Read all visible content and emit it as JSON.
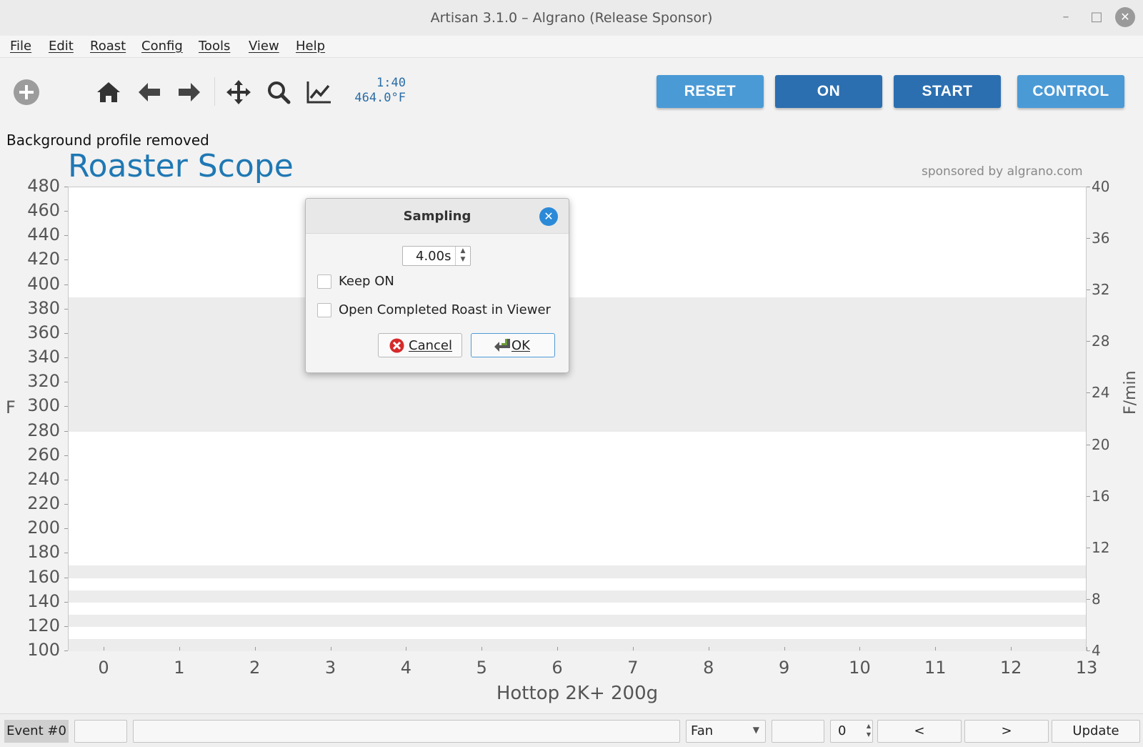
{
  "window": {
    "title": "Artisan 3.1.0 – Algrano (Release Sponsor)",
    "minimize": "–",
    "maximize": "□",
    "close": "✕"
  },
  "menu": [
    "File",
    "Edit",
    "Roast",
    "Config",
    "Tools",
    "View",
    "Help"
  ],
  "toolbar": {
    "time": "1:40",
    "temperature": "464.0°F",
    "buttons": [
      {
        "label": "RESET",
        "color": "#4a9ad6"
      },
      {
        "label": "ON",
        "color": "#2b6fb0"
      },
      {
        "label": "START",
        "color": "#2b6fb0"
      },
      {
        "label": "CONTROL",
        "color": "#4a9ad6"
      }
    ]
  },
  "status": "Background profile removed",
  "chart_data": {
    "type": "line",
    "title": "Roaster Scope",
    "sponsor": "sponsored by algrano.com",
    "xlabel": "Hottop 2K+ 200g",
    "ylabel": "F",
    "ylabel_right": "F/min",
    "xlim": [
      0,
      13
    ],
    "ylim": [
      100,
      480
    ],
    "ylim_right": [
      4,
      40
    ],
    "x_ticks": [
      "0",
      "1",
      "2",
      "3",
      "4",
      "5",
      "6",
      "7",
      "8",
      "9",
      "10",
      "11",
      "12",
      "13"
    ],
    "y_ticks": [
      "480",
      "460",
      "440",
      "420",
      "400",
      "380",
      "360",
      "340",
      "320",
      "300",
      "280",
      "260",
      "240",
      "220",
      "200",
      "180",
      "160",
      "140",
      "120",
      "100"
    ],
    "y_ticks_right": [
      "40",
      "36",
      "32",
      "28",
      "24",
      "20",
      "16",
      "12",
      "8",
      "4"
    ],
    "shaded_bands": [
      [
        280,
        390
      ],
      [
        160,
        170
      ],
      [
        140,
        150
      ],
      [
        120,
        130
      ],
      [
        100,
        110
      ]
    ],
    "series": []
  },
  "dialog": {
    "title": "Sampling",
    "interval": "4.00s",
    "keep_on": "Keep ON",
    "open_viewer": "Open Completed Roast in Viewer",
    "cancel": "Cancel",
    "ok": "OK"
  },
  "bottom": {
    "event": "Event #0",
    "type_select": "Fan",
    "value": "0",
    "prev": "<",
    "next": ">",
    "update": "Update"
  }
}
